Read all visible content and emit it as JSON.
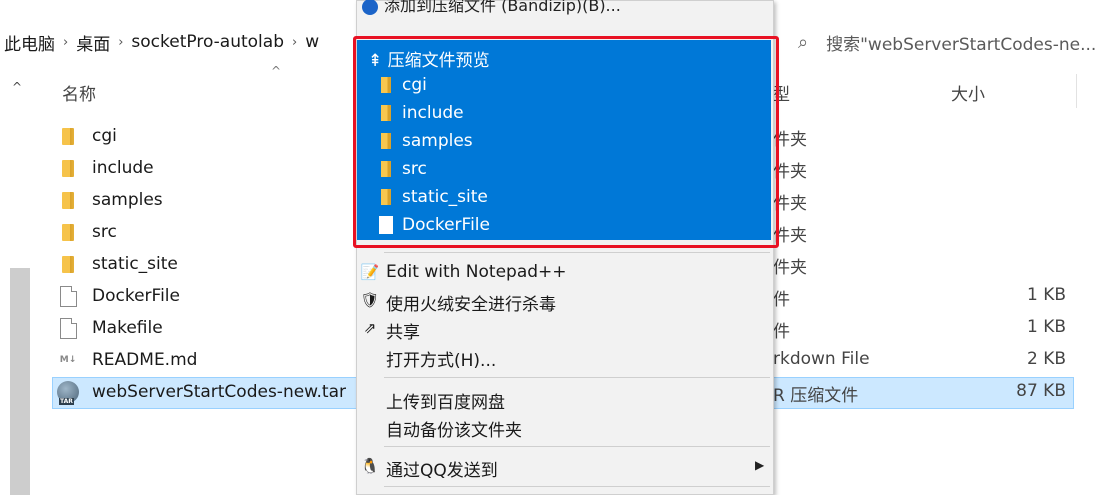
{
  "breadcrumb": {
    "items": [
      "此电脑",
      "桌面",
      "socketPro-autolab",
      "w"
    ],
    "separator": "›"
  },
  "search": {
    "placeholder": "搜索\"webServerStartCodes-ne..."
  },
  "columns": {
    "name": "名称",
    "type": "型",
    "size": "大小"
  },
  "files": [
    {
      "name": "cgi",
      "icon": "folder-icon",
      "type": "件夹",
      "size": ""
    },
    {
      "name": "include",
      "icon": "folder-icon",
      "type": "件夹",
      "size": ""
    },
    {
      "name": "samples",
      "icon": "folder-icon",
      "type": "件夹",
      "size": ""
    },
    {
      "name": "src",
      "icon": "folder-icon",
      "type": "件夹",
      "size": ""
    },
    {
      "name": "static_site",
      "icon": "folder-icon",
      "type": "件夹",
      "size": ""
    },
    {
      "name": "DockerFile",
      "icon": "file-icon",
      "type": "件",
      "size": "1 KB"
    },
    {
      "name": "Makefile",
      "icon": "file-icon",
      "type": "件",
      "size": "1 KB"
    },
    {
      "name": "README.md",
      "icon": "markdown-file-icon",
      "type": "rkdown File",
      "size": "2 KB"
    },
    {
      "name": "webServerStartCodes-new.tar",
      "icon": "tar-archive-icon",
      "type": "R 压缩文件",
      "size": "87 KB"
    }
  ],
  "context_menu": {
    "top_item": "添加到压缩文件 (Bandizip)(B)...",
    "preview": {
      "title": "压缩文件预览",
      "items": [
        {
          "name": "cgi",
          "icon": "folder-icon"
        },
        {
          "name": "include",
          "icon": "folder-icon"
        },
        {
          "name": "samples",
          "icon": "folder-icon"
        },
        {
          "name": "src",
          "icon": "folder-icon"
        },
        {
          "name": "static_site",
          "icon": "folder-icon"
        },
        {
          "name": "DockerFile",
          "icon": "file-icon"
        }
      ]
    },
    "items": {
      "notepad": "Edit with Notepad++",
      "huorong": "使用火绒安全进行杀毒",
      "share": "共享",
      "open_with": "打开方式(H)...",
      "baidu_upload": "上传到百度网盘",
      "auto_backup": "自动备份该文件夹",
      "send_qq": "通过QQ发送到"
    }
  },
  "colors": {
    "preview_bg": "#0078d7",
    "highlight_border": "#e81123",
    "selection_bg": "#cce8ff"
  }
}
